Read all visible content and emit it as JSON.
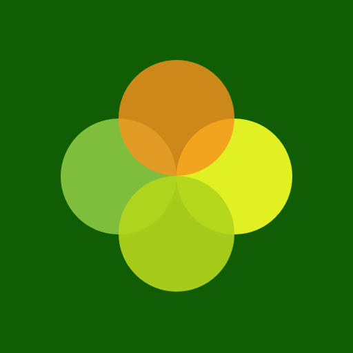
{
  "background_color": "#0f5e03",
  "logo": {
    "icon_name": "four-overlapping-circles-icon",
    "circles": [
      {
        "name": "circle-left",
        "color": "#7fbe3c",
        "opacity": 1.0
      },
      {
        "name": "circle-bottom",
        "color": "#b2d61c",
        "opacity": 0.92
      },
      {
        "name": "circle-right",
        "color": "#e0f023",
        "opacity": 1.0
      },
      {
        "name": "circle-top",
        "color": "#f7931e",
        "opacity": 0.82
      }
    ]
  }
}
